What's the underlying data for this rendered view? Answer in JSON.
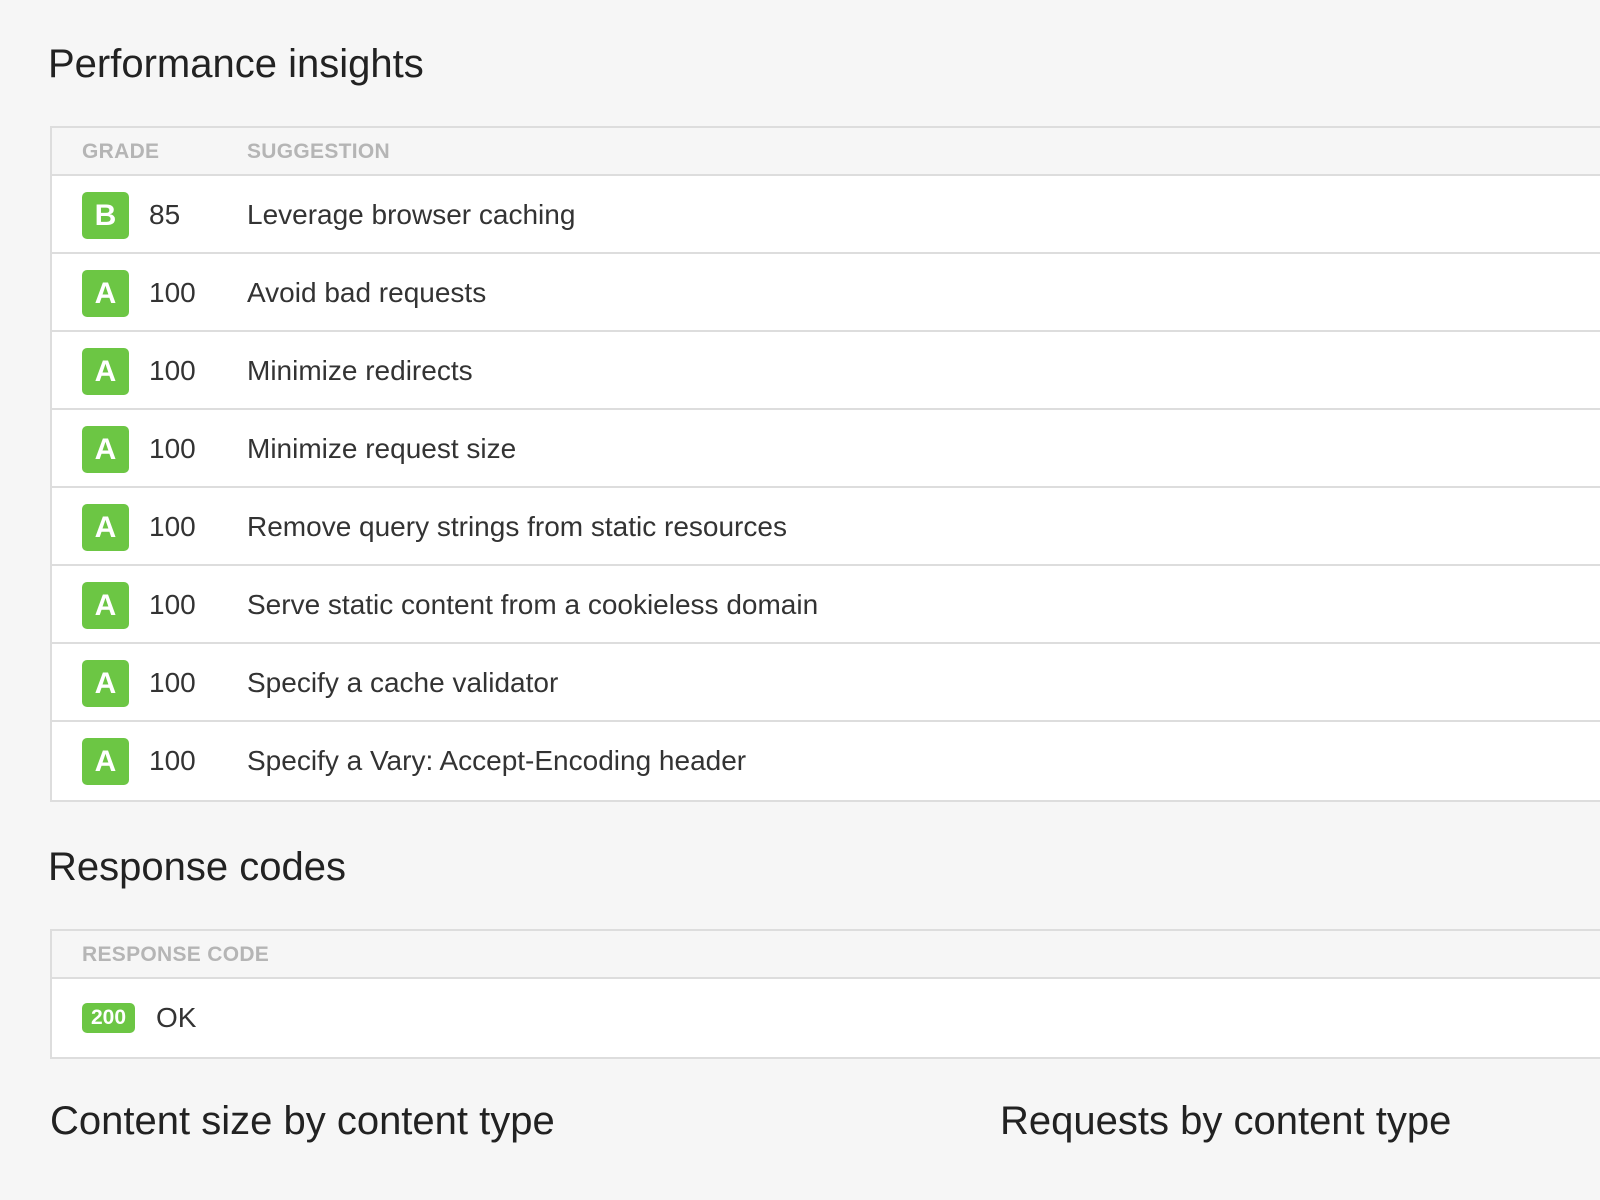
{
  "colors": {
    "badge_green": "#6cc644",
    "background": "#f6f6f6",
    "panel_border": "#dddddd",
    "header_text": "#b5b5b5"
  },
  "insights": {
    "title": "Performance insights",
    "headers": {
      "grade": "GRADE",
      "suggestion": "SUGGESTION"
    },
    "rows": [
      {
        "grade": "B",
        "score": "85",
        "suggestion": "Leverage browser caching"
      },
      {
        "grade": "A",
        "score": "100",
        "suggestion": "Avoid bad requests"
      },
      {
        "grade": "A",
        "score": "100",
        "suggestion": "Minimize redirects"
      },
      {
        "grade": "A",
        "score": "100",
        "suggestion": "Minimize request size"
      },
      {
        "grade": "A",
        "score": "100",
        "suggestion": "Remove query strings from static resources"
      },
      {
        "grade": "A",
        "score": "100",
        "suggestion": "Serve static content from a cookieless domain"
      },
      {
        "grade": "A",
        "score": "100",
        "suggestion": "Specify a cache validator"
      },
      {
        "grade": "A",
        "score": "100",
        "suggestion": "Specify a Vary: Accept-Encoding header"
      }
    ]
  },
  "response_codes": {
    "title": "Response codes",
    "header": "RESPONSE CODE",
    "rows": [
      {
        "code": "200",
        "text": "OK"
      }
    ]
  },
  "content_size": {
    "title": "Content size by content type"
  },
  "requests_by_type": {
    "title": "Requests by content type"
  }
}
